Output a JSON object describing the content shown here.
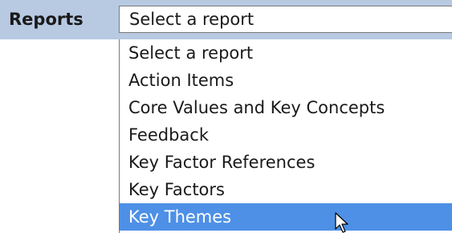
{
  "reports": {
    "label": "Reports",
    "selected_value": "Select a report",
    "options": [
      {
        "label": "Select a report"
      },
      {
        "label": "Action Items"
      },
      {
        "label": "Core Values and Key Concepts"
      },
      {
        "label": "Feedback"
      },
      {
        "label": "Key Factor References"
      },
      {
        "label": "Key Factors"
      },
      {
        "label": "Key Themes",
        "highlighted": true
      }
    ]
  },
  "colors": {
    "header_band": "#b8c9e2",
    "highlight": "#4d90e6"
  },
  "icons": {
    "cursor": "mouse-pointer-icon"
  }
}
